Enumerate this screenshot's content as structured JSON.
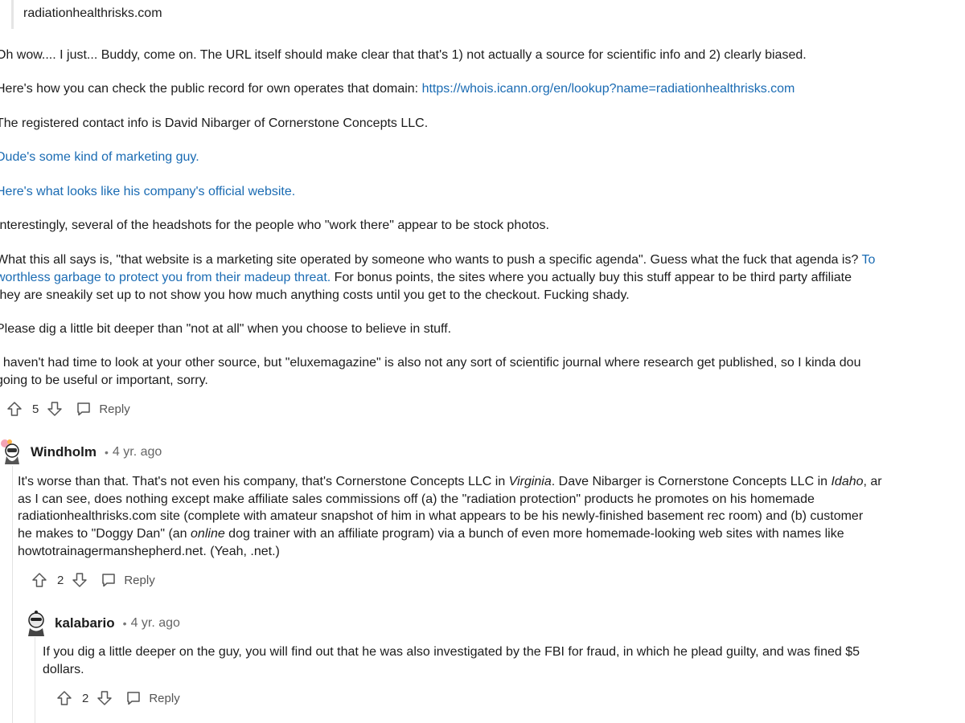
{
  "quoted_url": "radiationhealthrisks.com",
  "top_comment": {
    "p1": "Oh wow.... I just... Buddy, come on. The URL itself should make clear that that's 1) not actually a source for scientific info and 2) clearly biased.",
    "p2_text": "Here's how you can check the public record for own operates that domain: ",
    "p2_link": "https://whois.icann.org/en/lookup?name=radiationhealthrisks.com",
    "p3": "The registered contact info is David Nibarger of Cornerstone Concepts LLC.",
    "p4_link": "Dude's some kind of marketing guy.",
    "p5_link": "Here's what looks like his company's official website.",
    "p6": "Interestingly, several of the headshots for the people who \"work there\" appear to be stock photos.",
    "p7_line1_text": "What this all says is, \"that website is a marketing site operated by someone who wants to push a specific agenda\". Guess what the fuck that agenda is? ",
    "p7_line1_link": "To",
    "p7_line2_link": "worthless garbage to protect you from their madeup threat.",
    "p7_line2_text": " For bonus points, the sites where you actually buy this stuff appear to be third party affiliate",
    "p7_line3": "they are sneakily set up to not show you how much anything costs until you get to the checkout. Fucking shady.",
    "p8": "Please dig a little bit deeper than \"not at all\" when you choose to believe in stuff.",
    "p9_line1": "I haven't had time to look at your other source, but \"eluxemagazine\" is also not any sort of scientific journal where research get published, so I kinda dou",
    "p9_line2": "going to be useful or important, sorry.",
    "votes": "5",
    "reply_label": "Reply"
  },
  "reply1": {
    "username": "Windholm",
    "dot": "•",
    "age": "4 yr. ago",
    "line1_a": "It's worse than that. That's not even his company, that's Cornerstone Concepts LLC in ",
    "line1_em1": "Virginia",
    "line1_b": ". Dave Nibarger is Cornerstone Concepts LLC in ",
    "line1_em2": "Idaho",
    "line1_c": ", ar",
    "line2": "as I can see, does nothing except make affiliate sales commissions off (a) the \"radiation protection\" products he promotes on his homemade",
    "line3": "radiationhealthrisks.com site (complete with amateur snapshot of him in what appears to be his newly-finished basement rec room) and (b) customer",
    "line4_a": "he makes to \"Doggy Dan\" (an ",
    "line4_em": "online",
    "line4_b": " dog trainer with an affiliate program) via a bunch of even more homemade-looking web sites with names like",
    "line5": "howtotrainagermanshepherd.net. (Yeah, .net.)",
    "votes": "2",
    "reply_label": "Reply"
  },
  "reply2": {
    "username": "kalabario",
    "dot": "•",
    "age": "4 yr. ago",
    "line1": "If you dig a little deeper on the guy, you will find out that he was also investigated by the FBI for fraud, in which he plead guilty, and was fined $5",
    "line2": "dollars.",
    "votes": "2",
    "reply_label": "Reply"
  },
  "icons": {
    "upvote": "arrow-up-icon",
    "downvote": "arrow-down-icon",
    "reply": "speech-bubble-icon"
  }
}
